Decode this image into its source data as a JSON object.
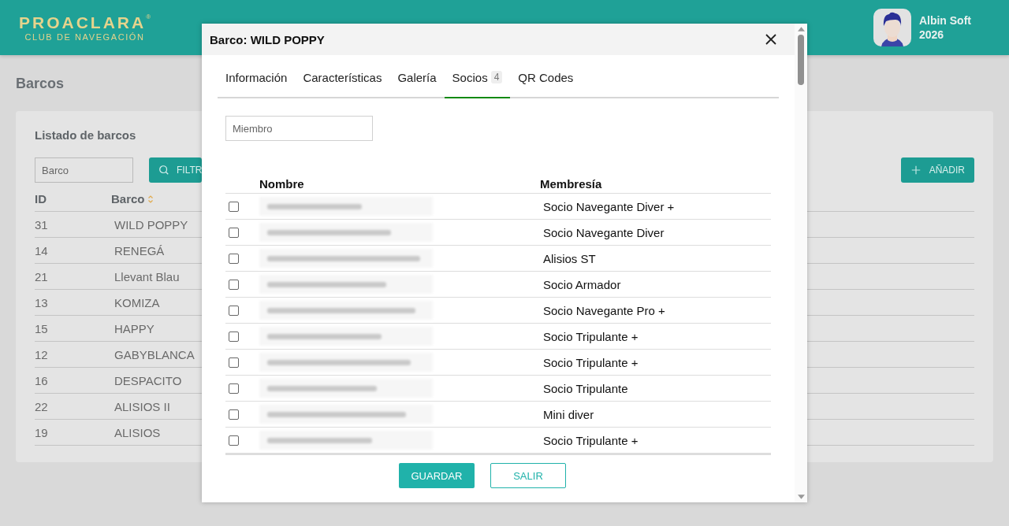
{
  "header": {
    "logo": {
      "name": "PROACLARA",
      "mark": "®",
      "subtitle": "CLUB DE NAVEGACIÓN"
    },
    "user": {
      "name": "Albin Soft",
      "year": "2026"
    }
  },
  "page": {
    "title": "Barcos",
    "card_title": "Listado de barcos",
    "filter": {
      "placeholder": "Barco"
    },
    "filter_button": "FILTR",
    "add_button": "AÑADIR",
    "columns": [
      "ID",
      "Barco"
    ],
    "rows": [
      {
        "id": "31",
        "name": "WILD POPPY"
      },
      {
        "id": "14",
        "name": "RENEGÁ"
      },
      {
        "id": "21",
        "name": "Llevant Blau"
      },
      {
        "id": "13",
        "name": "KOMIZA"
      },
      {
        "id": "15",
        "name": "HAPPY"
      },
      {
        "id": "12",
        "name": "GABYBLANCA"
      },
      {
        "id": "16",
        "name": "DESPACITO"
      },
      {
        "id": "22",
        "name": "ALISIOS II"
      },
      {
        "id": "19",
        "name": "ALISIOS"
      }
    ]
  },
  "dialog": {
    "title": "Barco: WILD POPPY",
    "tabs": [
      {
        "label": "Información",
        "selected": false
      },
      {
        "label": "Características",
        "selected": false
      },
      {
        "label": "Galería",
        "selected": false
      },
      {
        "label": "Socios",
        "badge": "4",
        "selected": true
      },
      {
        "label": "QR Codes",
        "selected": false
      }
    ],
    "search": {
      "placeholder": "Miembro"
    },
    "columns": [
      "Nombre",
      "Membresía"
    ],
    "members": [
      {
        "checked": false,
        "membership": "Socio Navegante Diver +"
      },
      {
        "checked": false,
        "membership": "Socio Navegante Diver"
      },
      {
        "checked": false,
        "membership": "Alisios ST"
      },
      {
        "checked": false,
        "membership": "Socio Armador"
      },
      {
        "checked": false,
        "membership": "Socio Navegante Pro +"
      },
      {
        "checked": false,
        "membership": "Socio Tripulante +"
      },
      {
        "checked": false,
        "membership": "Socio Tripulante +"
      },
      {
        "checked": false,
        "membership": "Socio Tripulante"
      },
      {
        "checked": false,
        "membership": "Mini diver"
      },
      {
        "checked": false,
        "membership": "Socio Tripulante +"
      }
    ],
    "buttons": [
      {
        "kind": "primary",
        "label": "GUARDAR"
      },
      {
        "kind": "secondary",
        "label": "SALIR"
      }
    ]
  }
}
